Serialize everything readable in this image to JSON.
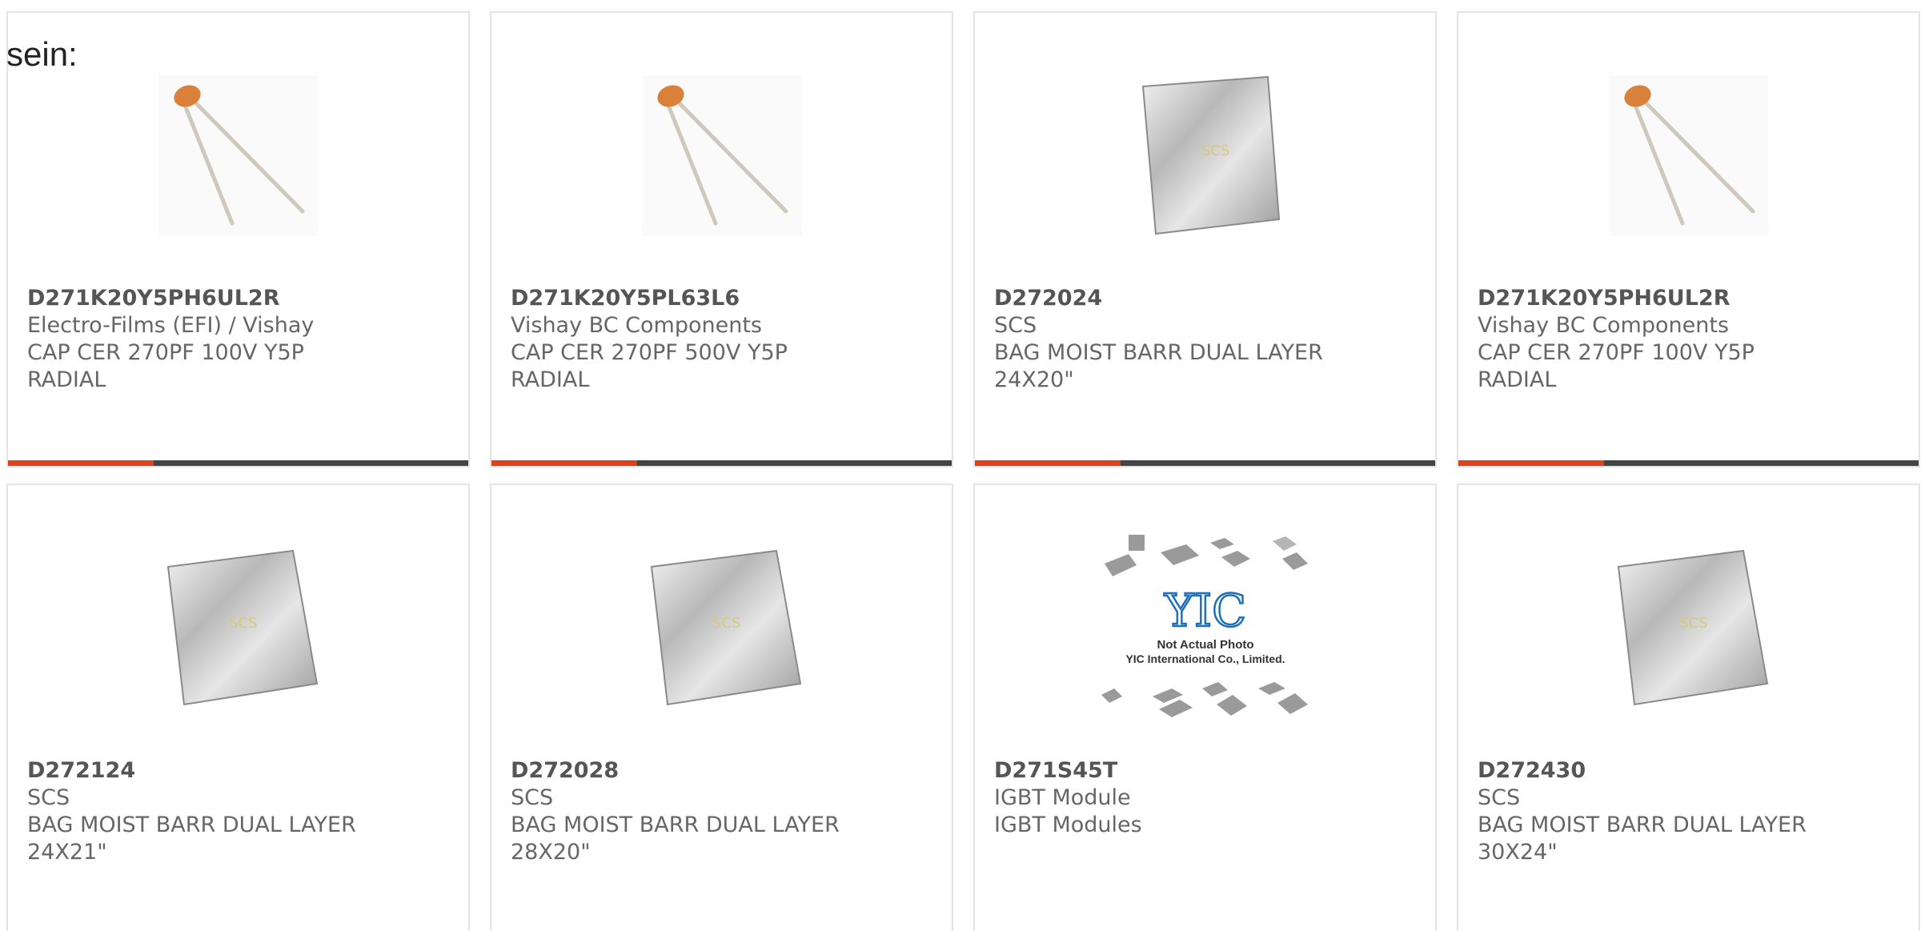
{
  "intro_text": "sein:",
  "colors": {
    "accent": "#e0411a",
    "bar": "#444444",
    "border": "#e4e4e4",
    "text": "#666666"
  },
  "products": [
    {
      "part": "D271K20Y5PH6UL2R",
      "maker": "Electro-Films (EFI) / Vishay",
      "desc1": "CAP CER 270PF 100V Y5P",
      "desc2": "RADIAL",
      "image": "capacitor-image",
      "has_bar": true
    },
    {
      "part": "D271K20Y5PL63L6",
      "maker": "Vishay BC Components",
      "desc1": "CAP CER 270PF 500V Y5P",
      "desc2": "RADIAL",
      "image": "capacitor-image",
      "has_bar": true
    },
    {
      "part": "D272024",
      "maker": "SCS",
      "desc1": "BAG MOIST BARR DUAL LAYER",
      "desc2": "24X20\"",
      "image": "moisture-bag-image",
      "has_bar": true
    },
    {
      "part": "D271K20Y5PH6UL2R",
      "maker": "Vishay BC Components",
      "desc1": "CAP CER 270PF 100V Y5P",
      "desc2": "RADIAL",
      "image": "capacitor-image",
      "has_bar": true
    },
    {
      "part": "D272124",
      "maker": "SCS",
      "desc1": "BAG MOIST BARR DUAL LAYER",
      "desc2": "24X21\"",
      "image": "moisture-bag-image",
      "has_bar": false
    },
    {
      "part": "D272028",
      "maker": "SCS",
      "desc1": "BAG MOIST BARR DUAL LAYER",
      "desc2": "28X20\"",
      "image": "moisture-bag-image",
      "has_bar": false
    },
    {
      "part": "D271S45T",
      "maker": "IGBT Module",
      "desc1": "IGBT Modules",
      "desc2": "",
      "image": "placeholder-image",
      "has_bar": false
    },
    {
      "part": "D272430",
      "maker": "SCS",
      "desc1": "BAG MOIST BARR DUAL LAYER",
      "desc2": "30X24\"",
      "image": "moisture-bag-image",
      "has_bar": false
    }
  ],
  "placeholder_logo": {
    "brand": "YIC",
    "line1": "Not Actual Photo",
    "line2": "YIC International Co., Limited."
  }
}
